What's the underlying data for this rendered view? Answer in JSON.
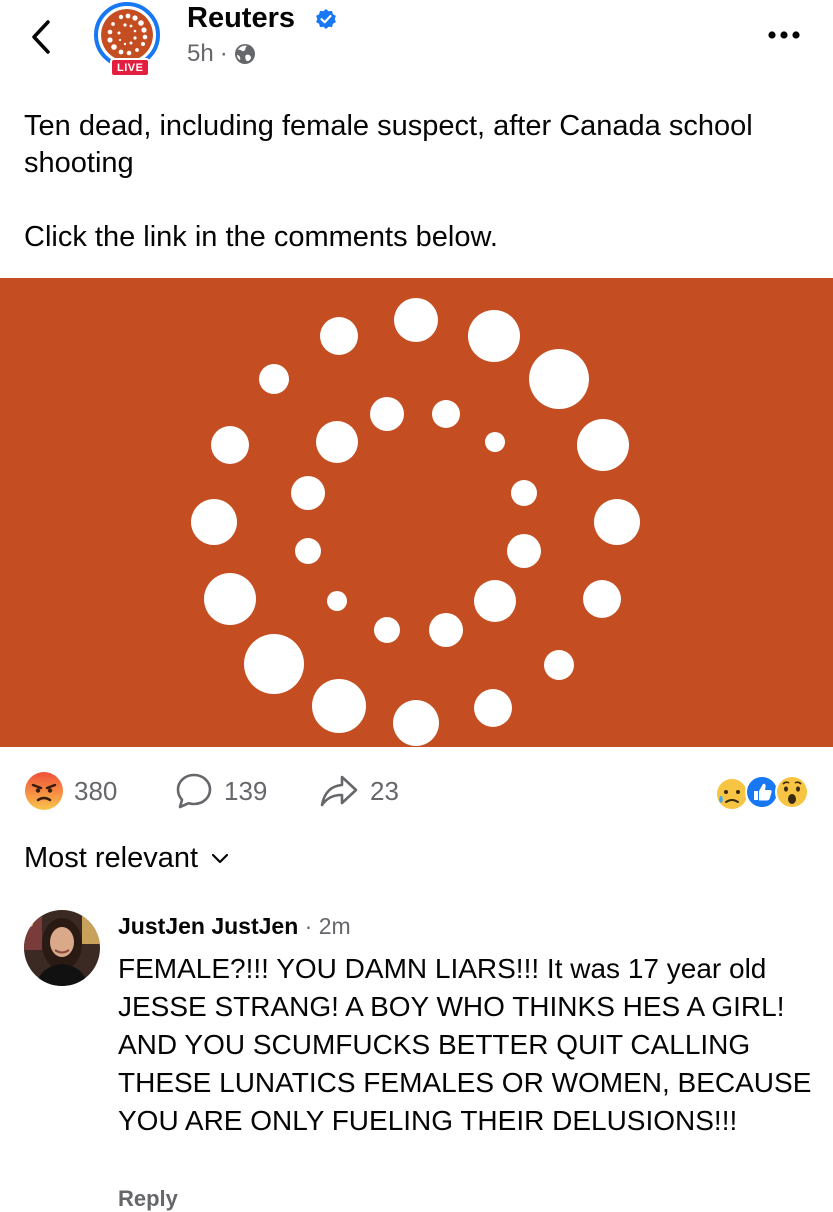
{
  "header": {
    "page_name": "Reuters",
    "time": "5h",
    "separator": "·",
    "live_badge": "LIVE"
  },
  "post": {
    "headline": "Ten dead, including female suspect, after Canada school shooting",
    "cta": "Click the link in the comments below."
  },
  "stats": {
    "reactions": "380",
    "comments": "139",
    "shares": "23"
  },
  "sort": {
    "label": "Most relevant"
  },
  "comment": {
    "author": "JustJen JustJen",
    "separator": "·",
    "time": "2m",
    "text": "FEMALE?!!! YOU DAMN LIARS!!! It was 17 year old JESSE STRANG! A BOY WHO THINKS HES A GIRL! AND YOU SCUMFUCKS BETTER QUIT CALLING THESE LUNATICS FEMALES OR WOMEN, BECAUSE YOU ARE ONLY FUELING THEIR DELUSIONS!!!",
    "footer": "Reply"
  },
  "colors": {
    "brand_orange": "#c44e21",
    "facebook_blue": "#1877f2",
    "live_red": "#e41e3f",
    "secondary_text": "#65676b"
  },
  "icons": [
    "back-arrow-icon",
    "verified-badge-icon",
    "globe-icon",
    "more-options-icon",
    "angry-reaction-icon",
    "comment-bubble-icon",
    "share-arrow-icon",
    "sad-reaction-icon",
    "like-reaction-icon",
    "wow-reaction-icon",
    "chevron-down-icon"
  ]
}
